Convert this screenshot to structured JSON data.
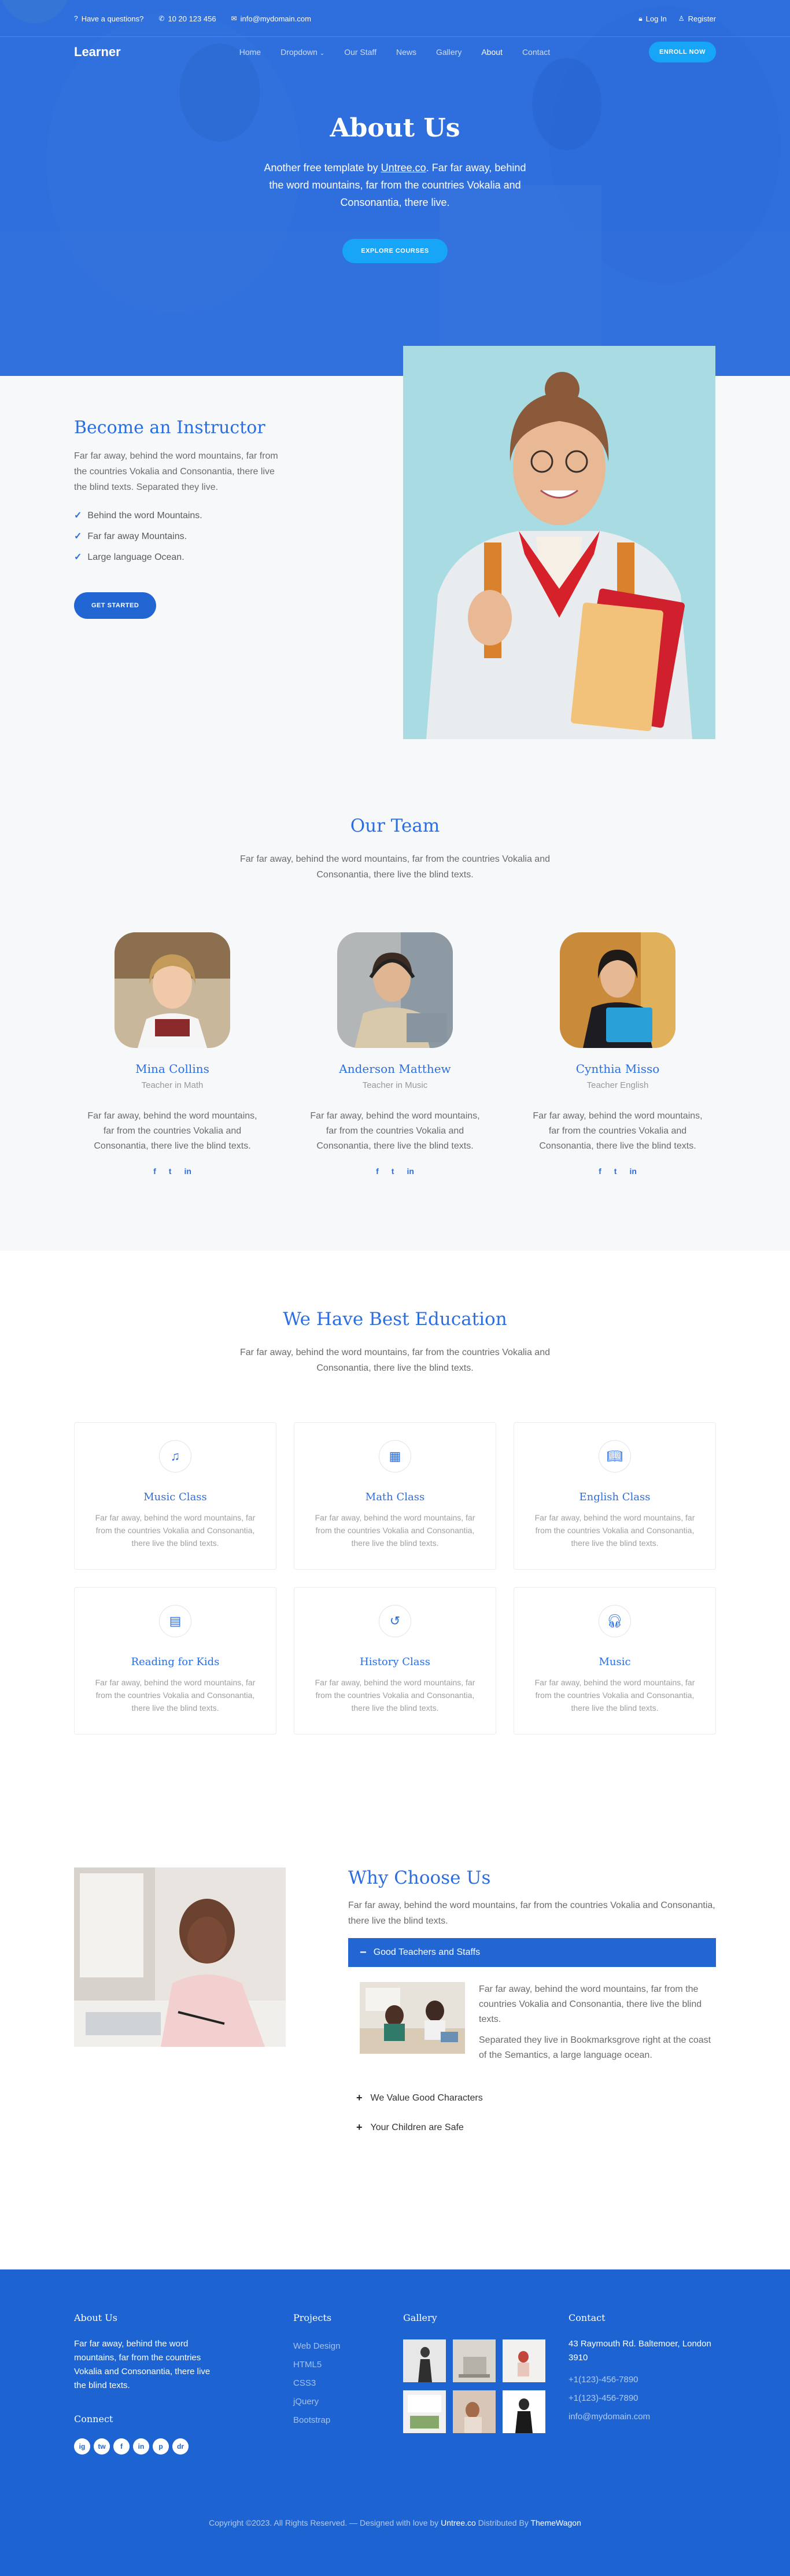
{
  "topbar": {
    "question": "Have a questions?",
    "phone": "10 20 123 456",
    "email": "info@mydomain.com",
    "login": "Log In",
    "register": "Register"
  },
  "nav": {
    "logo": "Learner",
    "items": [
      "Home",
      "Dropdown",
      "Our Staff",
      "News",
      "Gallery",
      "About",
      "Contact"
    ],
    "active": "About",
    "enroll": "ENROLL NOW"
  },
  "hero": {
    "title": "About Us",
    "text_before": "Another free template by ",
    "text_link": "Untree.co",
    "text_after": ". Far far away, behind the word mountains, far from the countries Vokalia and Consonantia, there live.",
    "button": "EXPLORE COURSES"
  },
  "instructor": {
    "title": "Become an Instructor",
    "text": "Far far away, behind the word mountains, far from the countries Vokalia and Consonantia, there live the blind texts. Separated they live.",
    "checks": [
      "Behind the word Mountains.",
      "Far far away Mountains.",
      "Large language Ocean."
    ],
    "button": "GET STARTED"
  },
  "team": {
    "title": "Our Team",
    "subtitle": "Far far away, behind the word mountains, far from the countries Vokalia and Consonantia, there live the blind texts.",
    "members": [
      {
        "name": "Mina Collins",
        "role": "Teacher in Math",
        "text": "Far far away, behind the word mountains, far from the countries Vokalia and Consonantia, there live the blind texts."
      },
      {
        "name": "Anderson Matthew",
        "role": "Teacher in Music",
        "text": "Far far away, behind the word mountains, far from the countries Vokalia and Consonantia, there live the blind texts."
      },
      {
        "name": "Cynthia Misso",
        "role": "Teacher English",
        "text": "Far far away, behind the word mountains, far from the countries Vokalia and Consonantia, there live the blind texts."
      }
    ],
    "social_icons": [
      "f",
      "t",
      "in"
    ]
  },
  "education": {
    "title": "We Have Best Education",
    "subtitle": "Far far away, behind the word mountains, far from the countries Vokalia and Consonantia, there live the blind texts.",
    "cards": [
      {
        "title": "Music Class",
        "icon": "music-icon",
        "text": "Far far away, behind the word mountains, far from the countries Vokalia and Consonantia, there live the blind texts."
      },
      {
        "title": "Math Class",
        "icon": "calculator-icon",
        "text": "Far far away, behind the word mountains, far from the countries Vokalia and Consonantia, there live the blind texts."
      },
      {
        "title": "English Class",
        "icon": "book-icon",
        "text": "Far far away, behind the word mountains, far from the countries Vokalia and Consonantia, there live the blind texts."
      },
      {
        "title": "Reading for Kids",
        "icon": "reader-icon",
        "text": "Far far away, behind the word mountains, far from the countries Vokalia and Consonantia, there live the blind texts."
      },
      {
        "title": "History Class",
        "icon": "history-icon",
        "text": "Far far away, behind the word mountains, far from the countries Vokalia and Consonantia, there live the blind texts."
      },
      {
        "title": "Music",
        "icon": "headphones-icon",
        "text": "Far far away, behind the word mountains, far from the countries Vokalia and Consonantia, there live the blind texts."
      }
    ]
  },
  "why": {
    "title": "Why Choose Us",
    "text": "Far far away, behind the word mountains, far from the countries Vokalia and Consonantia, there live the blind texts.",
    "open_item": "Good Teachers and Staffs",
    "open_para1": "Far far away, behind the word mountains, far from the countries Vokalia and Consonantia, there live the blind texts.",
    "open_para2": "Separated they live in Bookmarksgrove right at the coast of the Semantics, a large language ocean.",
    "items": [
      "We Value Good Characters",
      "Your Children are Safe"
    ]
  },
  "footer": {
    "about_title": "About Us",
    "about_text": "Far far away, behind the word mountains, far from the countries Vokalia and Consonantia, there live the blind texts.",
    "connect_title": "Connect",
    "social_icons": [
      "ig",
      "tw",
      "f",
      "in",
      "p",
      "dr"
    ],
    "projects_title": "Projects",
    "projects": [
      "Web Design",
      "HTML5",
      "CSS3",
      "jQuery",
      "Bootstrap"
    ],
    "gallery_title": "Gallery",
    "contact_title": "Contact",
    "address": "43 Raymouth Rd. Baltemoer, London 3910",
    "phone1": "+1(123)-456-7890",
    "phone2": "+1(123)-456-7890",
    "email": "info@mydomain.com",
    "copyright_prefix": "Copyright ©2023. All Rights Reserved. — Designed with love by ",
    "copyright_untree": "Untree.co",
    "copyright_mid": " Distributed By ",
    "copyright_tw": "ThemeWagon"
  },
  "colors": {
    "primary": "#2266d4",
    "accent": "#17a6f7",
    "heading": "#2b6ee0"
  }
}
